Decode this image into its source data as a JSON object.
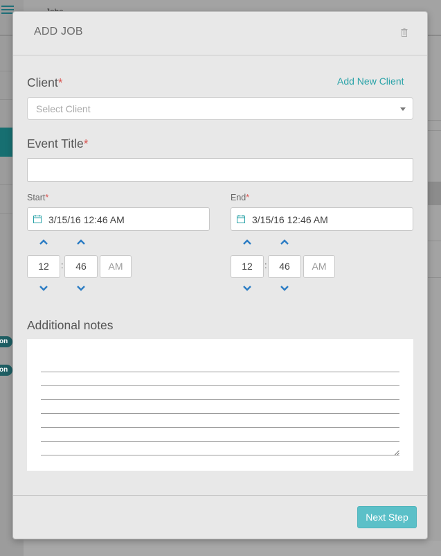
{
  "background": {
    "header_text": "Jobs",
    "pill_labels": [
      "on",
      "on"
    ]
  },
  "modal": {
    "title": "ADD JOB",
    "icons": {
      "delete": "trash-icon",
      "calendar": "calendar-icon",
      "up": "chevron-up-icon",
      "down": "chevron-down-icon"
    },
    "client": {
      "label": "Client",
      "required_mark": "*",
      "add_link": "Add New Client",
      "placeholder": "Select Client"
    },
    "event_title": {
      "label": "Event Title",
      "required_mark": "*",
      "value": ""
    },
    "start": {
      "label": "Start",
      "required_mark": "*",
      "datetime": "3/15/16 12:46 AM",
      "hour": "12",
      "minute": "46",
      "meridian": "AM",
      "separator": ":"
    },
    "end": {
      "label": "End",
      "required_mark": "*",
      "datetime": "3/15/16 12:46 AM",
      "hour": "12",
      "minute": "46",
      "meridian": "AM",
      "separator": ":"
    },
    "notes": {
      "label": "Additional notes",
      "value": ""
    },
    "next_button": "Next Step"
  },
  "colors": {
    "accent": "#2aa3a8",
    "button": "#5bc0c8",
    "required": "#d9534f",
    "spinner": "#2b7cc4"
  }
}
